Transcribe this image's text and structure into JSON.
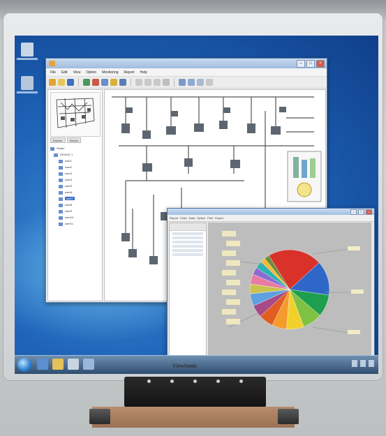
{
  "monitor": {
    "brand": "ViewSonic",
    "buttons": [
      "power",
      "menu",
      "down",
      "up",
      "select"
    ]
  },
  "main_window": {
    "title": "",
    "menu": [
      "File",
      "Edit",
      "View",
      "Option",
      "Monitoring",
      "Report",
      "Help"
    ],
    "left_tabs": [
      "Explore",
      "Device"
    ],
    "tree": [
      {
        "label": "Studio",
        "selected": false
      },
      {
        "label": "DEVICE 1",
        "selected": false
      },
      {
        "label": "user1",
        "selected": false
      },
      {
        "label": "user2",
        "selected": false
      },
      {
        "label": "user3",
        "selected": false
      },
      {
        "label": "user4",
        "selected": false
      },
      {
        "label": "user5",
        "selected": false
      },
      {
        "label": "user6",
        "selected": false
      },
      {
        "label": "user7",
        "selected": true
      },
      {
        "label": "user8",
        "selected": false
      },
      {
        "label": "user9",
        "selected": false
      },
      {
        "label": "user10",
        "selected": false
      },
      {
        "label": "user11",
        "selected": false
      }
    ]
  },
  "report_window": {
    "tabs": [
      "Report",
      "Chart",
      "Data",
      "Option",
      "Print",
      "Export"
    ]
  },
  "colors": {
    "desktop": "#1f63b8",
    "accent": "#3a6fc6",
    "monitor_bezel": "#dfe2e4"
  },
  "chart_data": {
    "type": "pie",
    "title": "",
    "values": [
      22,
      14,
      9,
      8,
      7,
      6,
      6,
      5,
      5,
      4,
      4,
      3,
      3,
      2,
      2
    ],
    "colors": [
      "#d8322b",
      "#2f67c8",
      "#1e9f4f",
      "#7fc241",
      "#f2d02b",
      "#f59b2d",
      "#e25d22",
      "#a74a86",
      "#5fa0e0",
      "#c9c24d",
      "#e87aa3",
      "#8a6bd1",
      "#2ab3b0",
      "#f4b93a",
      "#6d8d3a"
    ]
  }
}
